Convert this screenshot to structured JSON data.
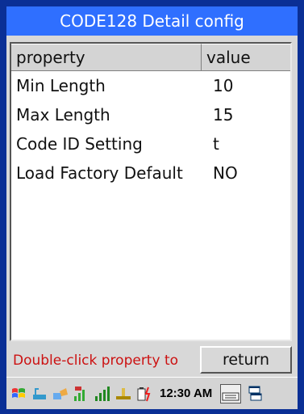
{
  "window": {
    "title": "CODE128 Detail config"
  },
  "list": {
    "columns": {
      "property": "property",
      "value": "value"
    },
    "rows": [
      {
        "property": "Min Length",
        "value": "10"
      },
      {
        "property": "Max Length",
        "value": "15"
      },
      {
        "property": "Code ID Setting",
        "value": "t"
      },
      {
        "property": "Load Factory Default",
        "value": "NO"
      }
    ]
  },
  "footer": {
    "hint": "Double-click property to",
    "return_label": "return"
  },
  "taskbar": {
    "clock": "12:30 AM",
    "icons": [
      "start-flag-icon",
      "usb-icon",
      "network-icon",
      "signal-icon",
      "signal-bars-icon",
      "power-icon",
      "battery-icon",
      "keyboard-icon",
      "window-switch-icon"
    ]
  },
  "colors": {
    "frame": "#0a2f95",
    "title_bar": "#2f6fff",
    "hint_text": "#cc1111"
  }
}
